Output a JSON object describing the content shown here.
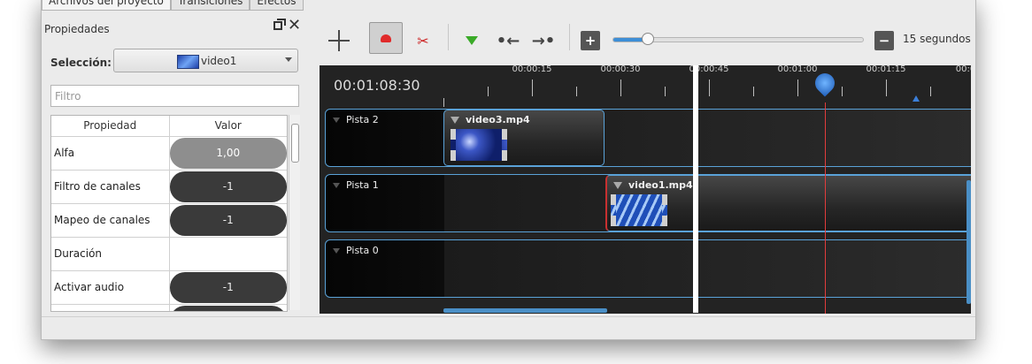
{
  "top_tabs": [
    "Archivos del proyecto",
    "Transiciones",
    "Efectos"
  ],
  "properties": {
    "title": "Propiedades",
    "selection_label": "Selección:",
    "selection_value": "video1",
    "filter_placeholder": "Filtro",
    "columns": [
      "Propiedad",
      "Valor"
    ],
    "rows": [
      {
        "name": "Alfa",
        "value": "1,00",
        "style": "light"
      },
      {
        "name": "Filtro de canales",
        "value": "-1",
        "style": "dark"
      },
      {
        "name": "Mapeo de canales",
        "value": "-1",
        "style": "dark"
      },
      {
        "name": "Duración",
        "value": "",
        "style": "blank"
      },
      {
        "name": "Activar audio",
        "value": "-1",
        "style": "dark"
      },
      {
        "name": "",
        "value": "",
        "style": "dark"
      }
    ]
  },
  "toolbar": {
    "zoom_label": "15 segundos",
    "zoom_level": 0.14
  },
  "timeline": {
    "current_time": "00:01:08:30",
    "ruler_labels": [
      "00:00:15",
      "00:00:30",
      "00:00:45",
      "00:01:00",
      "00:01:15",
      "00:0"
    ],
    "tracks": [
      {
        "name": "Pista 2",
        "clips": [
          {
            "name": "video3.mp4",
            "thumb": "v3"
          }
        ]
      },
      {
        "name": "Pista 1",
        "clips": [
          {
            "name": "video1.mp4",
            "thumb": "v1"
          }
        ]
      },
      {
        "name": "Pista 0",
        "clips": []
      }
    ]
  }
}
